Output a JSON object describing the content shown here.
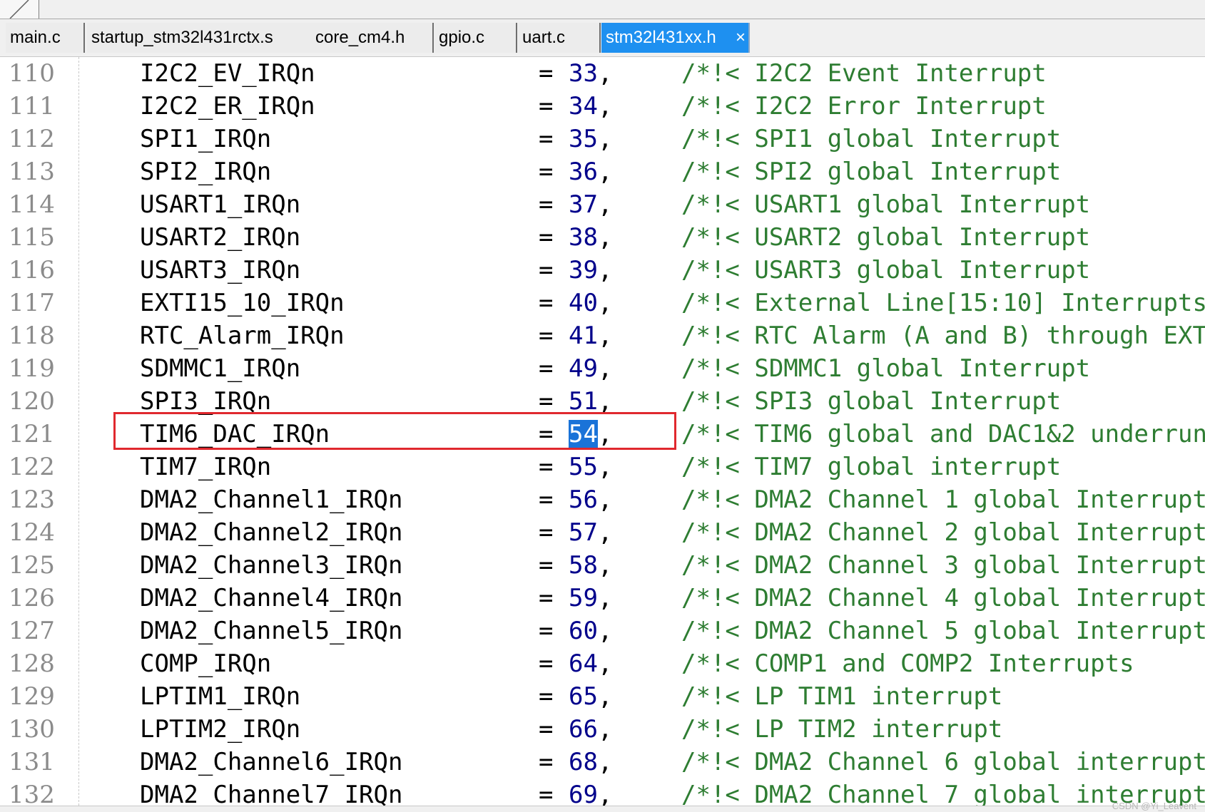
{
  "tabs": [
    {
      "label": "main.c",
      "active": false
    },
    {
      "label": "startup_stm32l431rctx.s",
      "active": false
    },
    {
      "label": "core_cm4.h",
      "active": false
    },
    {
      "label": "gpio.c",
      "active": false
    },
    {
      "label": "uart.c",
      "active": false
    },
    {
      "label": "stm32l431xx.h",
      "active": true
    }
  ],
  "close_glyph": "×",
  "code_lines": [
    {
      "n": "110",
      "name": "I2C2_EV_IRQn",
      "value": "33",
      "comment": "/*!< I2C2 Event Interrupt"
    },
    {
      "n": "111",
      "name": "I2C2_ER_IRQn",
      "value": "34",
      "comment": "/*!< I2C2 Error Interrupt"
    },
    {
      "n": "112",
      "name": "SPI1_IRQn",
      "value": "35",
      "comment": "/*!< SPI1 global Interrupt"
    },
    {
      "n": "113",
      "name": "SPI2_IRQn",
      "value": "36",
      "comment": "/*!< SPI2 global Interrupt"
    },
    {
      "n": "114",
      "name": "USART1_IRQn",
      "value": "37",
      "comment": "/*!< USART1 global Interrupt"
    },
    {
      "n": "115",
      "name": "USART2_IRQn",
      "value": "38",
      "comment": "/*!< USART2 global Interrupt"
    },
    {
      "n": "116",
      "name": "USART3_IRQn",
      "value": "39",
      "comment": "/*!< USART3 global Interrupt"
    },
    {
      "n": "117",
      "name": "EXTI15_10_IRQn",
      "value": "40",
      "comment": "/*!< External Line[15:10] Interrupts"
    },
    {
      "n": "118",
      "name": "RTC_Alarm_IRQn",
      "value": "41",
      "comment": "/*!< RTC Alarm (A and B) through EXTI"
    },
    {
      "n": "119",
      "name": "SDMMC1_IRQn",
      "value": "49",
      "comment": "/*!< SDMMC1 global Interrupt"
    },
    {
      "n": "120",
      "name": "SPI3_IRQn",
      "value": "51",
      "comment": "/*!< SPI3 global Interrupt"
    },
    {
      "n": "121",
      "name": "TIM6_DAC_IRQn",
      "value": "54",
      "comment": "/*!< TIM6 global and DAC1&2 underrun",
      "selected": true
    },
    {
      "n": "122",
      "name": "TIM7_IRQn",
      "value": "55",
      "comment": "/*!< TIM7 global interrupt"
    },
    {
      "n": "123",
      "name": "DMA2_Channel1_IRQn",
      "value": "56",
      "comment": "/*!< DMA2 Channel 1 global Interrupt"
    },
    {
      "n": "124",
      "name": "DMA2_Channel2_IRQn",
      "value": "57",
      "comment": "/*!< DMA2 Channel 2 global Interrupt"
    },
    {
      "n": "125",
      "name": "DMA2_Channel3_IRQn",
      "value": "58",
      "comment": "/*!< DMA2 Channel 3 global Interrupt"
    },
    {
      "n": "126",
      "name": "DMA2_Channel4_IRQn",
      "value": "59",
      "comment": "/*!< DMA2 Channel 4 global Interrupt"
    },
    {
      "n": "127",
      "name": "DMA2_Channel5_IRQn",
      "value": "60",
      "comment": "/*!< DMA2 Channel 5 global Interrupt"
    },
    {
      "n": "128",
      "name": "COMP_IRQn",
      "value": "64",
      "comment": "/*!< COMP1 and COMP2 Interrupts"
    },
    {
      "n": "129",
      "name": "LPTIM1_IRQn",
      "value": "65",
      "comment": "/*!< LP TIM1 interrupt"
    },
    {
      "n": "130",
      "name": "LPTIM2_IRQn",
      "value": "66",
      "comment": "/*!< LP TIM2 interrupt"
    },
    {
      "n": "131",
      "name": "DMA2_Channel6_IRQn",
      "value": "68",
      "comment": "/*!< DMA2 Channel 6 global interrupt"
    },
    {
      "n": "132",
      "name": "DMA2_Channel7_IRQn",
      "value": "69",
      "comment": "/*!< DMA2 Channel 7 global interrupt"
    }
  ],
  "eq_sign": "=",
  "comma": ",",
  "watermark": "CSDN @Yi_Leavent",
  "colors": {
    "identifier": "#000000",
    "number": "#00008b",
    "comment": "#2e7d32",
    "line_number": "#8b8b8b",
    "active_tab": "#1e90f0",
    "selection": "#1a73d8",
    "highlight_box": "#e0282e"
  }
}
